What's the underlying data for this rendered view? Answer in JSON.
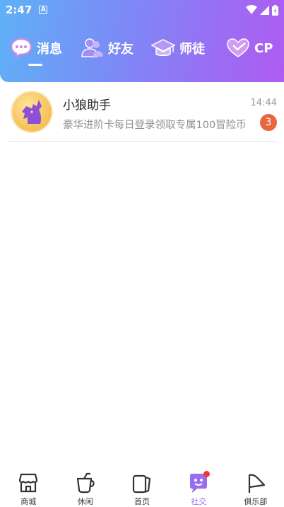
{
  "status_bar": {
    "time": "2:47",
    "indicator": "A"
  },
  "tabs": [
    {
      "label": "消息",
      "icon": "chat-bubble-icon",
      "active": true
    },
    {
      "label": "好友",
      "icon": "friends-icon",
      "active": false
    },
    {
      "label": "师徒",
      "icon": "graduation-cap-icon",
      "active": false
    },
    {
      "label": "CP",
      "icon": "heart-icon",
      "active": false
    }
  ],
  "messages": [
    {
      "name": "小狼助手",
      "time": "14:44",
      "preview": "豪华进阶卡每日登录领取专属100冒险币",
      "unread": "3",
      "avatar": "wolf-avatar"
    }
  ],
  "bottom_nav": [
    {
      "label": "商城",
      "icon": "store-icon",
      "active": false
    },
    {
      "label": "休闲",
      "icon": "cup-icon",
      "active": false
    },
    {
      "label": "首页",
      "icon": "card-icon",
      "active": false
    },
    {
      "label": "社交",
      "icon": "social-chat-icon",
      "active": true,
      "dot": true
    },
    {
      "label": "俱乐部",
      "icon": "flag-icon",
      "active": false
    }
  ],
  "colors": {
    "header_start": "#5fb1f7",
    "header_end": "#ae5cf2",
    "active_nav": "#9b6cf0",
    "badge": "#e8663f",
    "notify_dot": "#f0382d"
  }
}
